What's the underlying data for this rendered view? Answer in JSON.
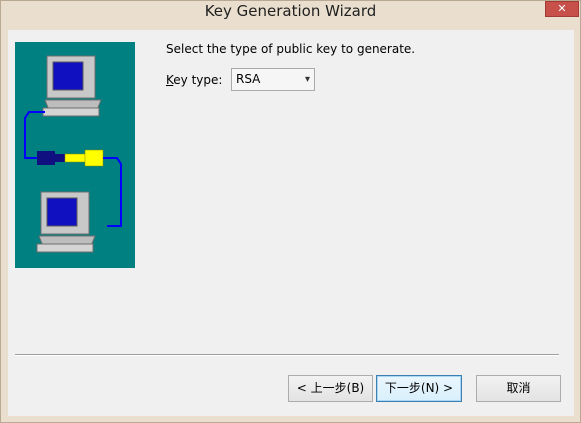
{
  "window": {
    "title": "Key Generation Wizard",
    "close_glyph": "✕"
  },
  "content": {
    "prompt": "Select the type of public key to generate.",
    "key_type_label_underlined": "K",
    "key_type_label_rest": "ey type:",
    "key_type_value": "RSA",
    "dropdown_icon": "chevron-down-icon"
  },
  "buttons": {
    "back": "< 上一步(B)",
    "next": "下一步(N) >",
    "cancel": "取消"
  },
  "colors": {
    "illustration_bg": "#008080",
    "monitor_screen": "#1010c0",
    "key_dark": "#101080",
    "key_light": "#ffff00",
    "cable": "#0000ff"
  }
}
